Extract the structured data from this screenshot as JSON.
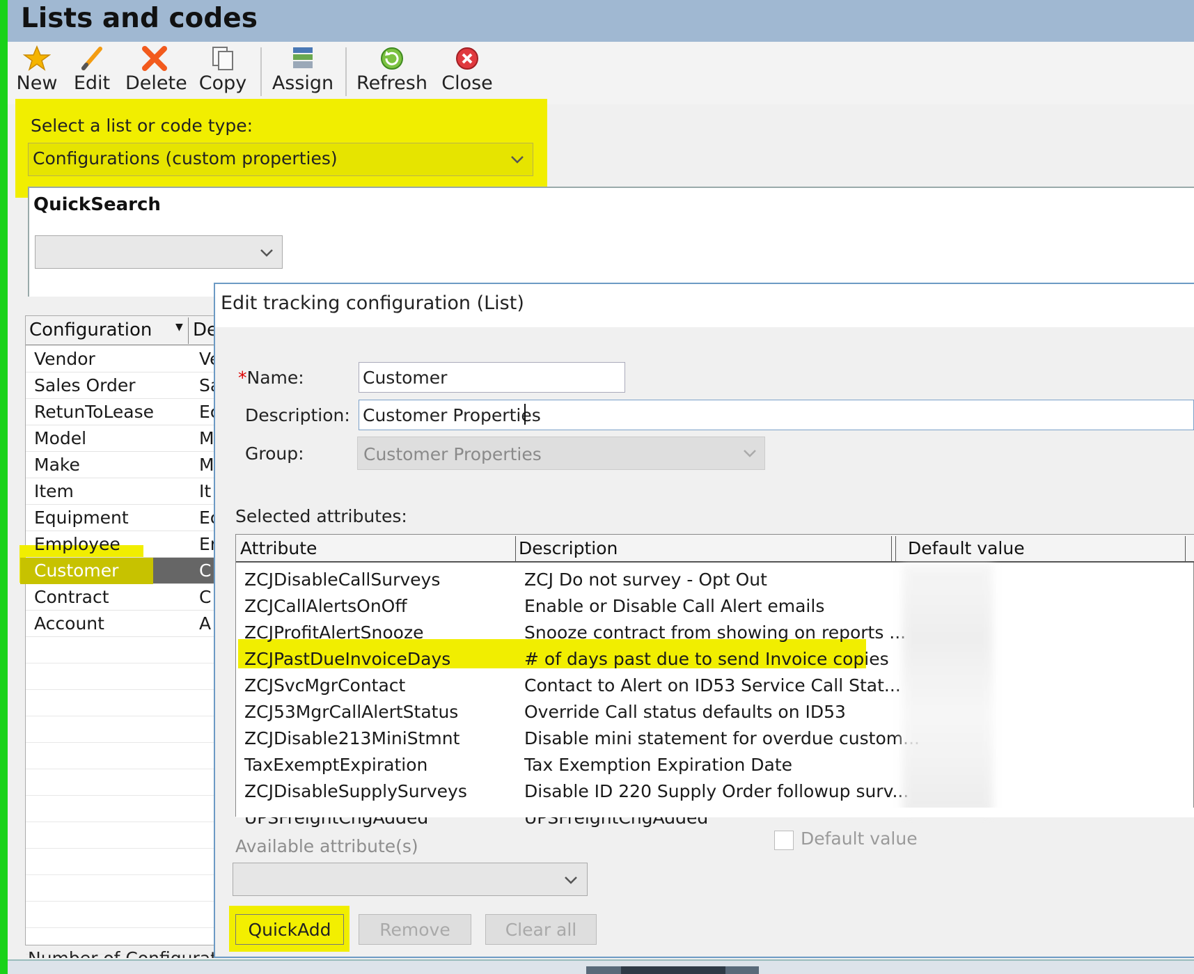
{
  "window": {
    "title": "Lists and codes"
  },
  "toolbar": {
    "new": "New",
    "edit": "Edit",
    "delete": "Delete",
    "copy": "Copy",
    "assign": "Assign",
    "refresh": "Refresh",
    "close": "Close"
  },
  "type_select": {
    "label": "Select a list or code type:",
    "value": "Configurations (custom properties)"
  },
  "quicksearch": {
    "label": "QuickSearch"
  },
  "list": {
    "headers": {
      "configuration": "Configuration",
      "description": "De"
    },
    "rows": [
      {
        "name": "Vendor",
        "desc": "Ve"
      },
      {
        "name": "Sales Order",
        "desc": "Sa"
      },
      {
        "name": "RetunToLease",
        "desc": "Ec"
      },
      {
        "name": "Model",
        "desc": "M"
      },
      {
        "name": "Make",
        "desc": "M"
      },
      {
        "name": "Item",
        "desc": "It"
      },
      {
        "name": "Equipment",
        "desc": "Ec"
      },
      {
        "name": "Employee",
        "desc": "Er"
      },
      {
        "name": "Customer",
        "desc": "C"
      },
      {
        "name": "Contract",
        "desc": "C"
      },
      {
        "name": "Account",
        "desc": "A"
      }
    ],
    "selected": "Customer",
    "footer": "Number of Configurations"
  },
  "dialog": {
    "title": "Edit tracking configuration (List)",
    "name_label": "Name:",
    "name_value": "Customer",
    "desc_label": "Description:",
    "desc_value": "Customer Properties",
    "group_label": "Group:",
    "group_value": "Customer Properties",
    "selected_attributes_label": "Selected attributes:",
    "grid_headers": {
      "attribute": "Attribute",
      "description": "Description",
      "default_value": "Default value"
    },
    "attributes": [
      {
        "attribute": "ZCJDisableCallSurveys",
        "description": "ZCJ Do not survey - Opt Out"
      },
      {
        "attribute": "ZCJCallAlertsOnOff",
        "description": "Enable or Disable Call Alert emails"
      },
      {
        "attribute": "ZCJProfitAlertSnooze",
        "description": "Snooze contract from showing on reports ..."
      },
      {
        "attribute": "ZCJPastDueInvoiceDays",
        "description": "# of days past due to send Invoice copies"
      },
      {
        "attribute": "ZCJSvcMgrContact",
        "description": "Contact to Alert on ID53 Service Call Stat..."
      },
      {
        "attribute": "ZCJ53MgrCallAlertStatus",
        "description": "Override Call status defaults on ID53"
      },
      {
        "attribute": "ZCJDisable213MiniStmnt",
        "description": "Disable mini statement for overdue custom..."
      },
      {
        "attribute": "TaxExemptExpiration",
        "description": "Tax Exemption Expiration Date"
      },
      {
        "attribute": "ZCJDisableSupplySurveys",
        "description": "Disable ID 220 Supply Order followup surv..."
      },
      {
        "attribute": "UPSFreightChgAdded",
        "description": "UPSFreightChgAdded"
      }
    ],
    "highlighted_attribute": "ZCJPastDueInvoiceDays",
    "default_value_checkbox": "Default value",
    "available_label": "Available attribute(s)",
    "buttons": {
      "quickadd": "QuickAdd",
      "remove": "Remove",
      "clear_all": "Clear all"
    }
  },
  "colors": {
    "highlight": "#f1ee00",
    "title_bar": "#a0b8d2",
    "left_edge": "#19d219",
    "selected_row": "#666666"
  }
}
